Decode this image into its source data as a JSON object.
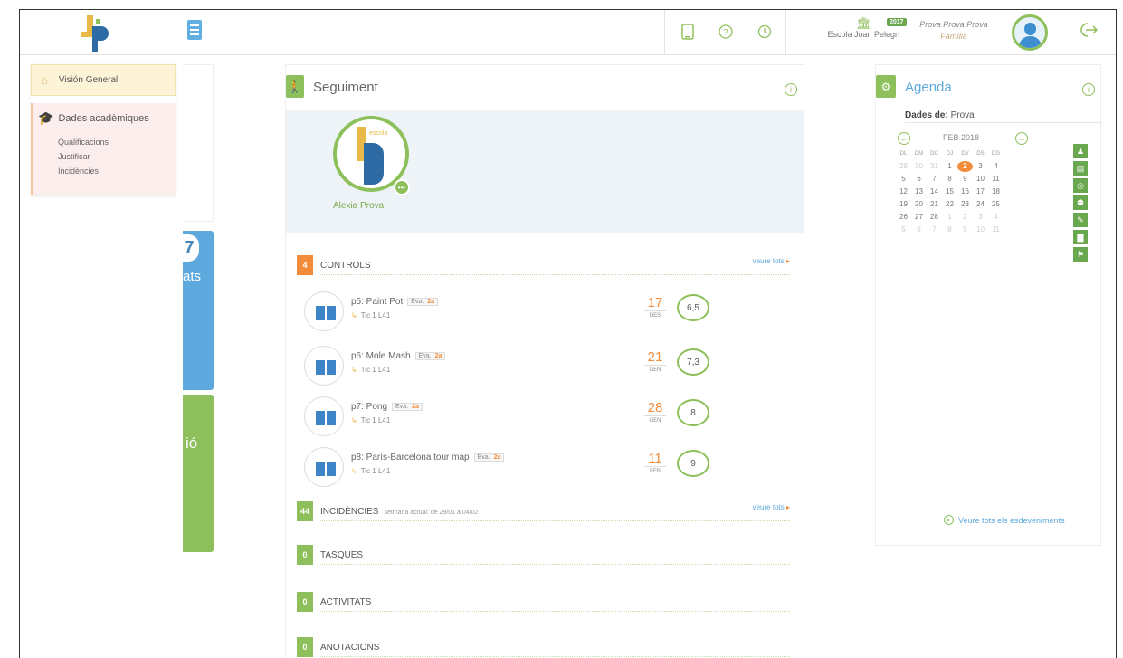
{
  "topbar": {
    "school_name": "Escola Joan Pelegrí",
    "year": "2017",
    "user_name": "Prova Prova Prova",
    "user_role": "Família"
  },
  "menu": {
    "overview": "Visión General",
    "academic": "Dades acadèmiques",
    "sub_items": [
      "Qualificacions",
      "Justificar",
      "Incidències"
    ]
  },
  "left_cards": {
    "blue_number": "7",
    "blue_text": "ats",
    "green_text": "ió"
  },
  "seguiment": {
    "title": "Seguiment",
    "student_name": "Alexia Prova",
    "controls": {
      "count": "4",
      "label": "CONTROLS",
      "see_all": "veure tots",
      "items": [
        {
          "title": "p5: Paint Pot",
          "tag": "Eva.",
          "tag_level": "2a",
          "subject": "Tic 1 L41",
          "day": "17",
          "month": "DES",
          "grade": "6,5"
        },
        {
          "title": "p6: Mole Mash",
          "tag": "Eva.",
          "tag_level": "2a",
          "subject": "Tic 1 L41",
          "day": "21",
          "month": "GEN",
          "grade": "7,3"
        },
        {
          "title": "p7: Pong",
          "tag": "Eva.",
          "tag_level": "2a",
          "subject": "Tic 1 L41",
          "day": "28",
          "month": "GEN",
          "grade": "8"
        },
        {
          "title": "p8: París-Barcelona tour map",
          "tag": "Eva.",
          "tag_level": "2a",
          "subject": "Tic 1 L41",
          "day": "11",
          "month": "FEB",
          "grade": "9"
        }
      ]
    },
    "incidencies": {
      "count": "44",
      "label": "INCIDÈNCIES",
      "sub": "setmana actual: de 29/01 a 04/02",
      "see_all": "veure tots"
    },
    "tasques": {
      "count": "0",
      "label": "TASQUES"
    },
    "activitats": {
      "count": "0",
      "label": "ACTIVITATS"
    },
    "anotacions": {
      "count": "0",
      "label": "ANOTACIONS"
    }
  },
  "agenda": {
    "title": "Agenda",
    "dades_label": "Dades de:",
    "dades_value": "Prova",
    "month": "FEB 2018",
    "weekdays": [
      "DL",
      "DM",
      "DC",
      "DJ",
      "DV",
      "DS",
      "DG"
    ],
    "days": [
      [
        "29",
        "30",
        "31",
        "1",
        "2",
        "3",
        "4"
      ],
      [
        "5",
        "6",
        "7",
        "8",
        "9",
        "10",
        "11"
      ],
      [
        "12",
        "13",
        "14",
        "15",
        "16",
        "17",
        "18"
      ],
      [
        "19",
        "20",
        "21",
        "22",
        "23",
        "24",
        "25"
      ],
      [
        "26",
        "27",
        "28",
        "1",
        "2",
        "3",
        "4"
      ],
      [
        "5",
        "6",
        "7",
        "8",
        "9",
        "10",
        "11"
      ]
    ],
    "today": "2",
    "see_all": "Veure tots els esdeveniments"
  },
  "colors": {
    "accent_green": "#8dc05a",
    "accent_orange": "#f28c3a",
    "accent_blue": "#5da9dd"
  }
}
